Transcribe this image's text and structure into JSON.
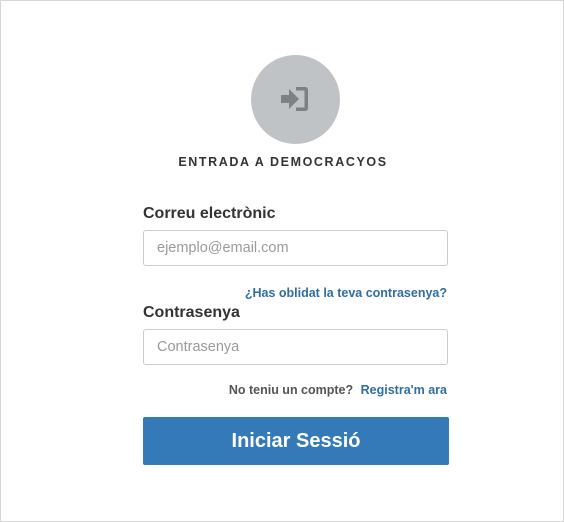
{
  "header": {
    "logo_icon": "sign-in-icon",
    "title": "ENTRADA A DEMOCRACYOS"
  },
  "form": {
    "email": {
      "label": "Correu electrònic",
      "placeholder": "ejemplo@email.com",
      "value": ""
    },
    "forgot_password_link": "¿Has oblidat la teva contrasenya?",
    "password": {
      "label": "Contrasenya",
      "placeholder": "Contrasenya",
      "value": ""
    },
    "signup": {
      "prompt": "No teniu un compte?",
      "link": "Registra'm ara"
    },
    "submit_label": "Iniciar Sessió"
  },
  "colors": {
    "accent": "#3479b8",
    "link": "#2f6ea3",
    "logo_circle": "#bfc3c6",
    "logo_glyph": "#7d8184"
  }
}
